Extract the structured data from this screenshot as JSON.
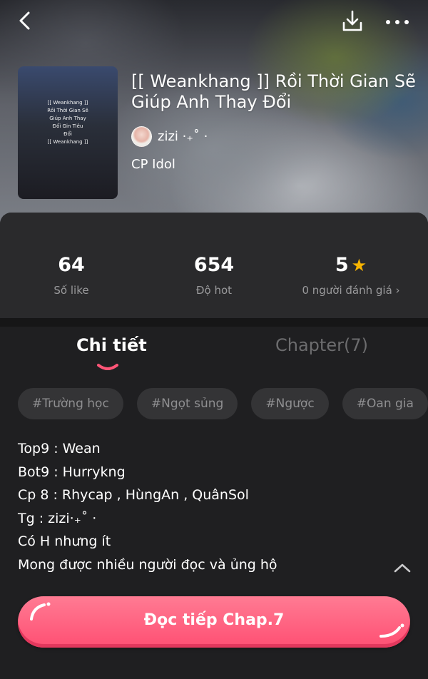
{
  "header": {
    "back_icon": "chevron-left-icon",
    "download_icon": "download-icon",
    "more_icon": "more-horizontal-icon"
  },
  "story": {
    "cover_lines": [
      "[[ Weankhang ]]",
      "Rồi Thời Gian Sẽ",
      "Giúp Anh Thay",
      "Đổi Gin Tiêu",
      "Đổi",
      "[[ Weankhang ]]"
    ],
    "title": "[[ Weankhang ]] Rồi Thời Gian Sẽ Giúp Anh Thay Đổi",
    "author": "zizi ·₊˚ ·",
    "category": "CP Idol"
  },
  "stats": {
    "likes": {
      "value": "64",
      "label": "Số like"
    },
    "hot": {
      "value": "654",
      "label": "Độ hot"
    },
    "rating": {
      "value": "5",
      "label": "0 người đánh giá ›"
    }
  },
  "tabs": {
    "detail": "Chi tiết",
    "chapters": "Chapter(7)"
  },
  "tags": [
    "#Trường học",
    "#Ngọt sủng",
    "#Ngược",
    "#Oan gia",
    "#"
  ],
  "description": [
    "Top9 : Wean",
    "Bot9 : Hurrykng",
    "Cp 8 : Rhycap , HùngAn , QuânSol",
    "Tg : zizi·₊˚ ·",
    "Có H nhưng ít",
    "Mong được nhiều người đọc và ủng hộ"
  ],
  "continue_button": "Đọc tiếp Chap.7",
  "colors": {
    "accent": "#ff5577",
    "star": "#f8b400",
    "background": "#1f1f21"
  }
}
